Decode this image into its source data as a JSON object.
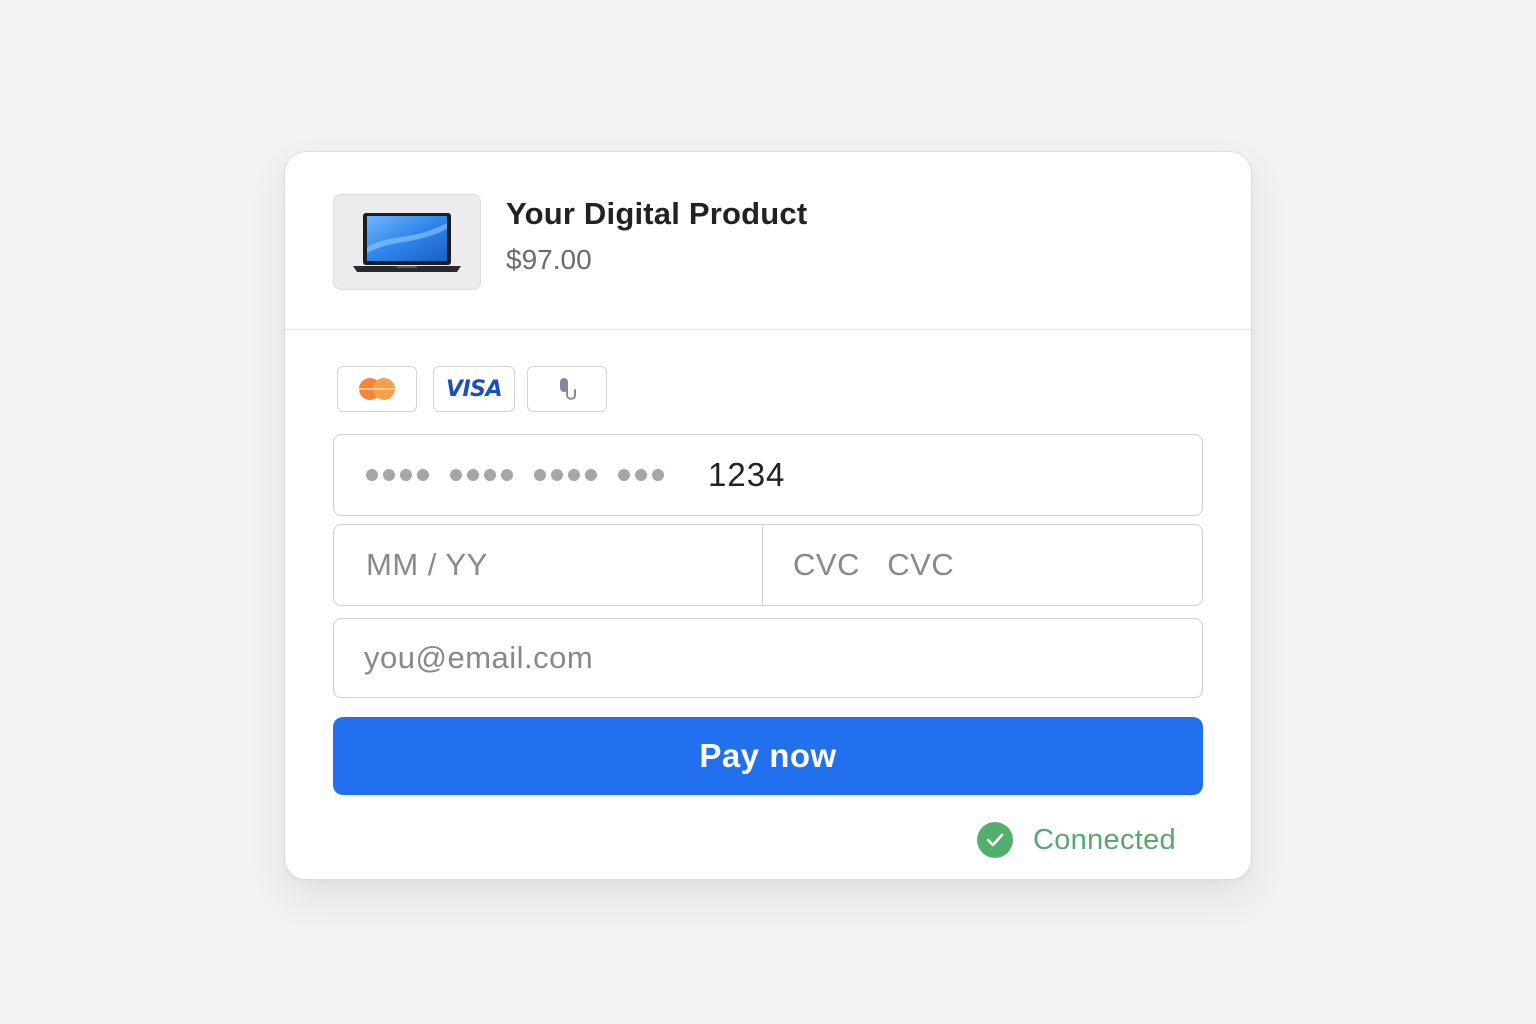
{
  "product": {
    "title": "Your Digital Product",
    "price": "$97.00",
    "image_icon": "laptop-icon"
  },
  "payment_methods": [
    {
      "name": "mastercard",
      "icon": "mastercard-icon"
    },
    {
      "name": "visa",
      "label": "VISA",
      "icon": "visa-logo"
    },
    {
      "name": "other",
      "icon": "wallet-icon"
    }
  ],
  "card_number": {
    "masked_groups": [
      4,
      4,
      4,
      3
    ],
    "last4": "1234"
  },
  "expiry": {
    "placeholder": "MM / YY"
  },
  "cvc": {
    "placeholder": "CVC   CVC"
  },
  "email": {
    "placeholder": "you@email.com"
  },
  "pay_button": {
    "label": "Pay now",
    "color": "#2170ee"
  },
  "status": {
    "text": "Connected",
    "icon": "check-circle-icon",
    "color": "#53b06c"
  }
}
